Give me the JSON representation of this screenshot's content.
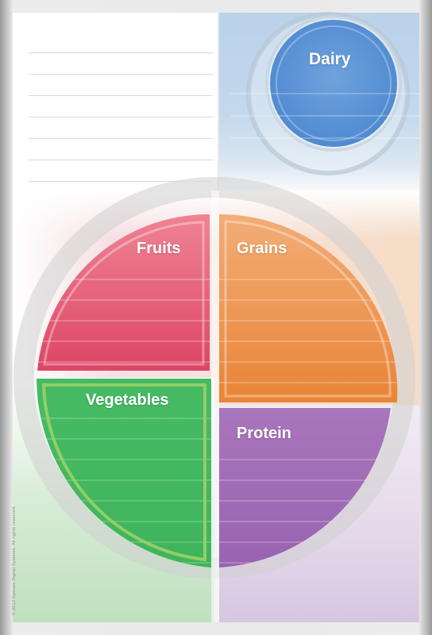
{
  "sections": {
    "dairy": {
      "label": "Dairy",
      "color": "#4a86d0"
    },
    "fruits": {
      "label": "Fruits",
      "color": "#e0506b"
    },
    "grains": {
      "label": "Grains",
      "color": "#ec8a42"
    },
    "vegetables": {
      "label": "Vegetables",
      "color": "#46bf62"
    },
    "protein": {
      "label": "Protein",
      "color": "#9f6ab6"
    }
  },
  "footer": {
    "copyright": "© 2012 Epicure Digital Systems. All rights reserved."
  }
}
